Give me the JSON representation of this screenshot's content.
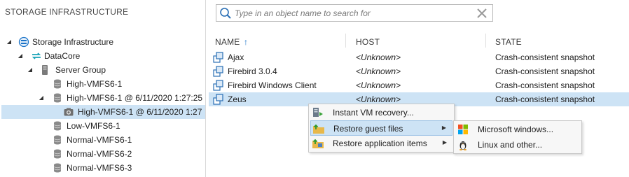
{
  "left_panel": {
    "header": "STORAGE INFRASTRUCTURE",
    "tree": [
      {
        "label": "Storage Infrastructure",
        "icon": "storage-infrastructure-icon",
        "expanded": true
      },
      {
        "label": "DataCore",
        "icon": "datacore-icon",
        "expanded": true
      },
      {
        "label": "Server Group",
        "icon": "server-group-icon",
        "expanded": true
      },
      {
        "label": "High-VMFS6-1",
        "icon": "volume-icon"
      },
      {
        "label": "High-VMFS6-1 @ 6/11/2020 1:27:25",
        "icon": "volume-icon",
        "expanded": true
      },
      {
        "label": "High-VMFS6-1 @ 6/11/2020 1:27",
        "icon": "snapshot-icon",
        "selected": true
      },
      {
        "label": "Low-VMFS6-1",
        "icon": "volume-icon"
      },
      {
        "label": "Normal-VMFS6-1",
        "icon": "volume-icon"
      },
      {
        "label": "Normal-VMFS6-2",
        "icon": "volume-icon"
      },
      {
        "label": "Normal-VMFS6-3",
        "icon": "volume-icon"
      }
    ]
  },
  "search": {
    "placeholder": "Type in an object name to search for",
    "value": ""
  },
  "grid": {
    "columns": [
      "NAME",
      "HOST",
      "STATE"
    ],
    "sort_indicator": "↑",
    "rows": [
      {
        "name": "Ajax",
        "host": "<Unknown>",
        "state": "Crash-consistent snapshot"
      },
      {
        "name": "Firebird 3.0.4",
        "host": "<Unknown>",
        "state": "Crash-consistent snapshot"
      },
      {
        "name": "Firebird Windows Client",
        "host": "<Unknown>",
        "state": "Crash-consistent snapshot"
      },
      {
        "name": "Zeus",
        "host": "<Unknown>",
        "state": "Crash-consistent snapshot",
        "selected": true
      }
    ]
  },
  "context_menu": {
    "items": [
      {
        "label": "Instant VM recovery...",
        "icon": "instant-recovery-icon"
      },
      {
        "label": "Restore guest files",
        "icon": "restore-guest-files-icon",
        "submenu": true,
        "highlighted": true
      },
      {
        "label": "Restore application items",
        "icon": "restore-app-items-icon",
        "submenu": true
      }
    ],
    "submenu": [
      {
        "label": "Microsoft windows...",
        "icon": "windows-icon"
      },
      {
        "label": "Linux and other...",
        "icon": "linux-icon"
      }
    ],
    "arrow": "▶"
  },
  "colors": {
    "selection": "#cde3f5",
    "accent": "#1a73c8"
  }
}
